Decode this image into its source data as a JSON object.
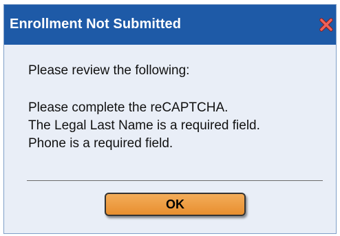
{
  "dialog": {
    "title": "Enrollment Not Submitted",
    "close_icon": "close-x-icon",
    "intro": "Please review the following:",
    "errors": [
      "Please complete the reCAPTCHA.",
      "The Legal Last Name is a required field.",
      "Phone is a required field."
    ],
    "ok_label": "OK"
  },
  "colors": {
    "titlebar": "#1e5aa7",
    "panel": "#e9eef7",
    "close_icon": "#e8544a",
    "ok_button": "#ef9e45"
  }
}
